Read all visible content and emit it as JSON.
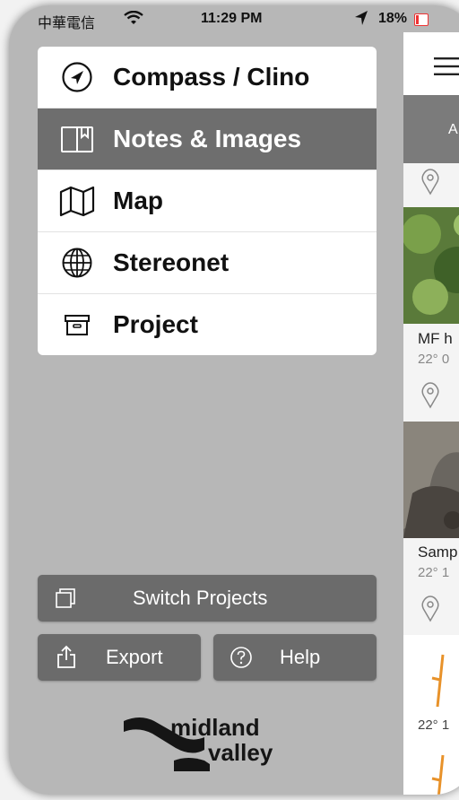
{
  "status_bar": {
    "carrier": "中華電信",
    "time": "11:29 PM",
    "battery": "18%"
  },
  "menu": {
    "items": [
      {
        "label": "Compass / Clino",
        "icon": "compass-arrow-icon",
        "active": false
      },
      {
        "label": "Notes & Images",
        "icon": "book-icon",
        "active": true
      },
      {
        "label": "Map",
        "icon": "map-icon",
        "active": false
      },
      {
        "label": "Stereonet",
        "icon": "globe-icon",
        "active": false
      },
      {
        "label": "Project",
        "icon": "archive-box-icon",
        "active": false
      }
    ]
  },
  "buttons": {
    "switch_projects": "Switch Projects",
    "export": "Export",
    "help": "Help"
  },
  "logo": {
    "line1": "midland",
    "line2": "valley"
  },
  "background_content": {
    "tab_fragment": "A",
    "notes": [
      {
        "title": "MF h",
        "subtitle": "22° 0"
      },
      {
        "title": "Samp",
        "subtitle": "22° 1"
      }
    ],
    "measurement_fragment": "22° 1"
  },
  "colors": {
    "sidebar_bg": "#b7b7b7",
    "active_item": "#6e6e6e",
    "button_bg": "#6b6b6b",
    "symbol_orange": "#e8922a"
  }
}
